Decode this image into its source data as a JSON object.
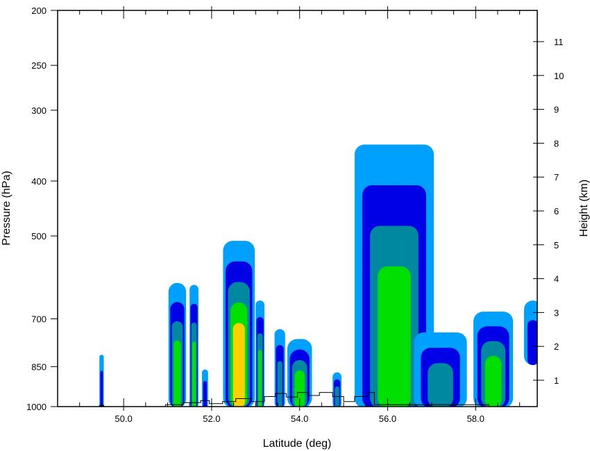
{
  "chart_data": {
    "type": "heatmap",
    "subtype": "filled-contour-cross-section",
    "xlabel": "Latitude (deg)",
    "ylabel": "Pressure (hPa)",
    "y2label": "Height (km)",
    "xlim": [
      48.5,
      59.4
    ],
    "ylim": [
      1000,
      200
    ],
    "yscale": "log",
    "grid": false,
    "x_ticks": [
      {
        "value": 50,
        "label": "50.0"
      },
      {
        "value": 52,
        "label": "52.0"
      },
      {
        "value": 54,
        "label": "54.0"
      },
      {
        "value": 56,
        "label": "56.0"
      },
      {
        "value": 58,
        "label": "58.0"
      }
    ],
    "y_ticks": [
      {
        "value": 200,
        "label": "200"
      },
      {
        "value": 250,
        "label": "250"
      },
      {
        "value": 300,
        "label": "300"
      },
      {
        "value": 400,
        "label": "400"
      },
      {
        "value": 500,
        "label": "500"
      },
      {
        "value": 700,
        "label": "700"
      },
      {
        "value": 850,
        "label": "850"
      },
      {
        "value": 1000,
        "label": "1000"
      }
    ],
    "y2_ticks": [
      {
        "value": 1,
        "label": "1"
      },
      {
        "value": 2,
        "label": "2"
      },
      {
        "value": 3,
        "label": "3"
      },
      {
        "value": 4,
        "label": "4"
      },
      {
        "value": 5,
        "label": "5"
      },
      {
        "value": 6,
        "label": "6"
      },
      {
        "value": 7,
        "label": "7"
      },
      {
        "value": 8,
        "label": "8"
      },
      {
        "value": 9,
        "label": "9"
      },
      {
        "value": 10,
        "label": "10"
      },
      {
        "value": 11,
        "label": "11"
      }
    ],
    "contour_colors": [
      "#00a0ff",
      "#0000e6",
      "#0088a0",
      "#00e000",
      "#ffd000"
    ],
    "cells": [
      {
        "x": 49.5,
        "halfwidth": 0.05,
        "top_p": 810,
        "bottom_p": 1000,
        "levels": 2
      },
      {
        "x": 51.22,
        "halfwidth": 0.2,
        "top_p": 605,
        "bottom_p": 1000,
        "levels": 4
      },
      {
        "x": 51.6,
        "halfwidth": 0.1,
        "top_p": 610,
        "bottom_p": 1000,
        "levels": 4
      },
      {
        "x": 51.85,
        "halfwidth": 0.07,
        "top_p": 860,
        "bottom_p": 1000,
        "levels": 2
      },
      {
        "x": 52.62,
        "halfwidth": 0.36,
        "top_p": 510,
        "bottom_p": 1000,
        "levels": 5
      },
      {
        "x": 53.1,
        "halfwidth": 0.1,
        "top_p": 650,
        "bottom_p": 1000,
        "levels": 4
      },
      {
        "x": 53.55,
        "halfwidth": 0.12,
        "top_p": 730,
        "bottom_p": 1000,
        "levels": 3
      },
      {
        "x": 54.0,
        "halfwidth": 0.28,
        "top_p": 760,
        "bottom_p": 1000,
        "levels": 4
      },
      {
        "x": 54.85,
        "halfwidth": 0.1,
        "top_p": 870,
        "bottom_p": 1000,
        "levels": 3
      },
      {
        "x": 55.5,
        "halfwidth": 0.1,
        "top_p": 830,
        "bottom_p": 1000,
        "levels": 4
      },
      {
        "x": 56.15,
        "halfwidth": 0.9,
        "top_p": 345,
        "bottom_p": 1000,
        "levels": 4
      },
      {
        "x": 57.2,
        "halfwidth": 0.6,
        "top_p": 740,
        "bottom_p": 1000,
        "levels": 3
      },
      {
        "x": 58.4,
        "halfwidth": 0.45,
        "top_p": 680,
        "bottom_p": 1000,
        "levels": 4
      },
      {
        "x": 59.3,
        "halfwidth": 0.2,
        "top_p": 650,
        "bottom_p": 840,
        "levels": 2
      }
    ]
  }
}
